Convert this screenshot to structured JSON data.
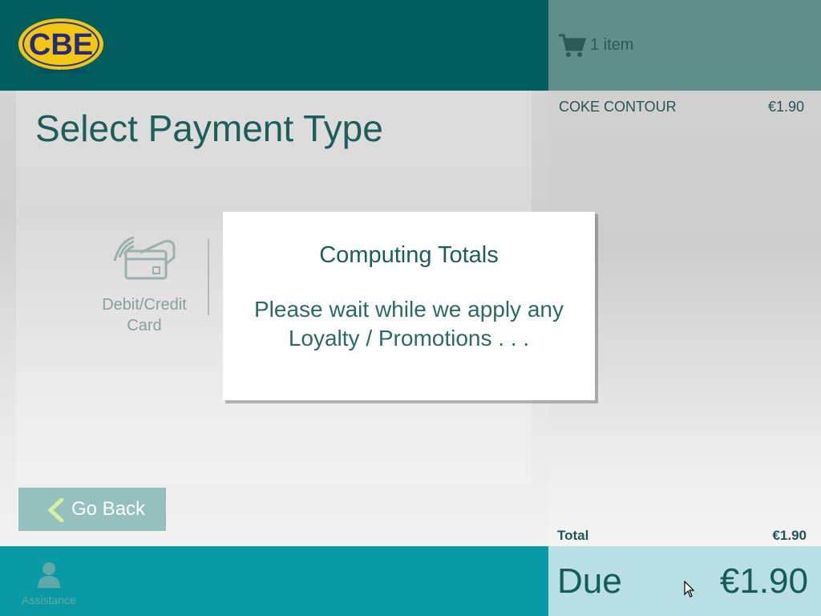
{
  "brand": {
    "logo_text": "CBE",
    "logo_subtext": "CONCANNON GROUP"
  },
  "page": {
    "title": "Select Payment Type"
  },
  "payment_options": [
    {
      "label_line1": "Debit/Credit",
      "label_line2": "Card",
      "icon": "contactless-card-icon"
    }
  ],
  "go_back": {
    "label": "Go Back"
  },
  "assistance": {
    "label": "Assistance",
    "icon": "person-icon"
  },
  "cart": {
    "count_label": "1 item",
    "items": [
      {
        "name": "COKE CONTOUR",
        "price": "€1.90"
      }
    ],
    "total_label": "Total",
    "total_value": "€1.90",
    "due_label": "Due",
    "due_value": "€1.90"
  },
  "modal": {
    "title": "Computing Totals",
    "message_line1": "Please wait while we apply any",
    "message_line2": "Loyalty / Promotions . . ."
  },
  "colors": {
    "header": "#005e5e",
    "footer": "#0a9aa6",
    "accent_text": "#1e5e59",
    "due_box": "#b8dfe3",
    "go_back_button": "#94c1bd"
  }
}
